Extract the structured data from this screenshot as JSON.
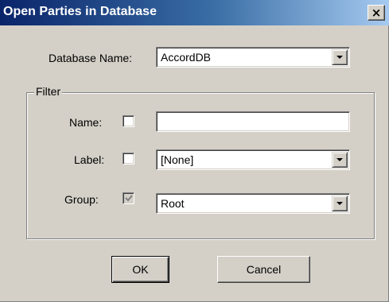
{
  "window": {
    "title": "Open Parties in Database",
    "close_glyph": "×"
  },
  "database": {
    "label": "Database Name:",
    "value": "AccordDB"
  },
  "filter": {
    "legend": "Filter",
    "name": {
      "label": "Name:",
      "checked": false,
      "value": ""
    },
    "label_row": {
      "label": "Label:",
      "checked": false,
      "value": "[None]"
    },
    "group": {
      "label": "Group:",
      "checked": true,
      "disabled": true,
      "value": "Root"
    }
  },
  "buttons": {
    "ok": "OK",
    "cancel": "Cancel"
  },
  "colors": {
    "face": "#d4d0c8",
    "title_start": "#0a246a",
    "title_end": "#a6caf0",
    "disabled_check": "#808080"
  }
}
